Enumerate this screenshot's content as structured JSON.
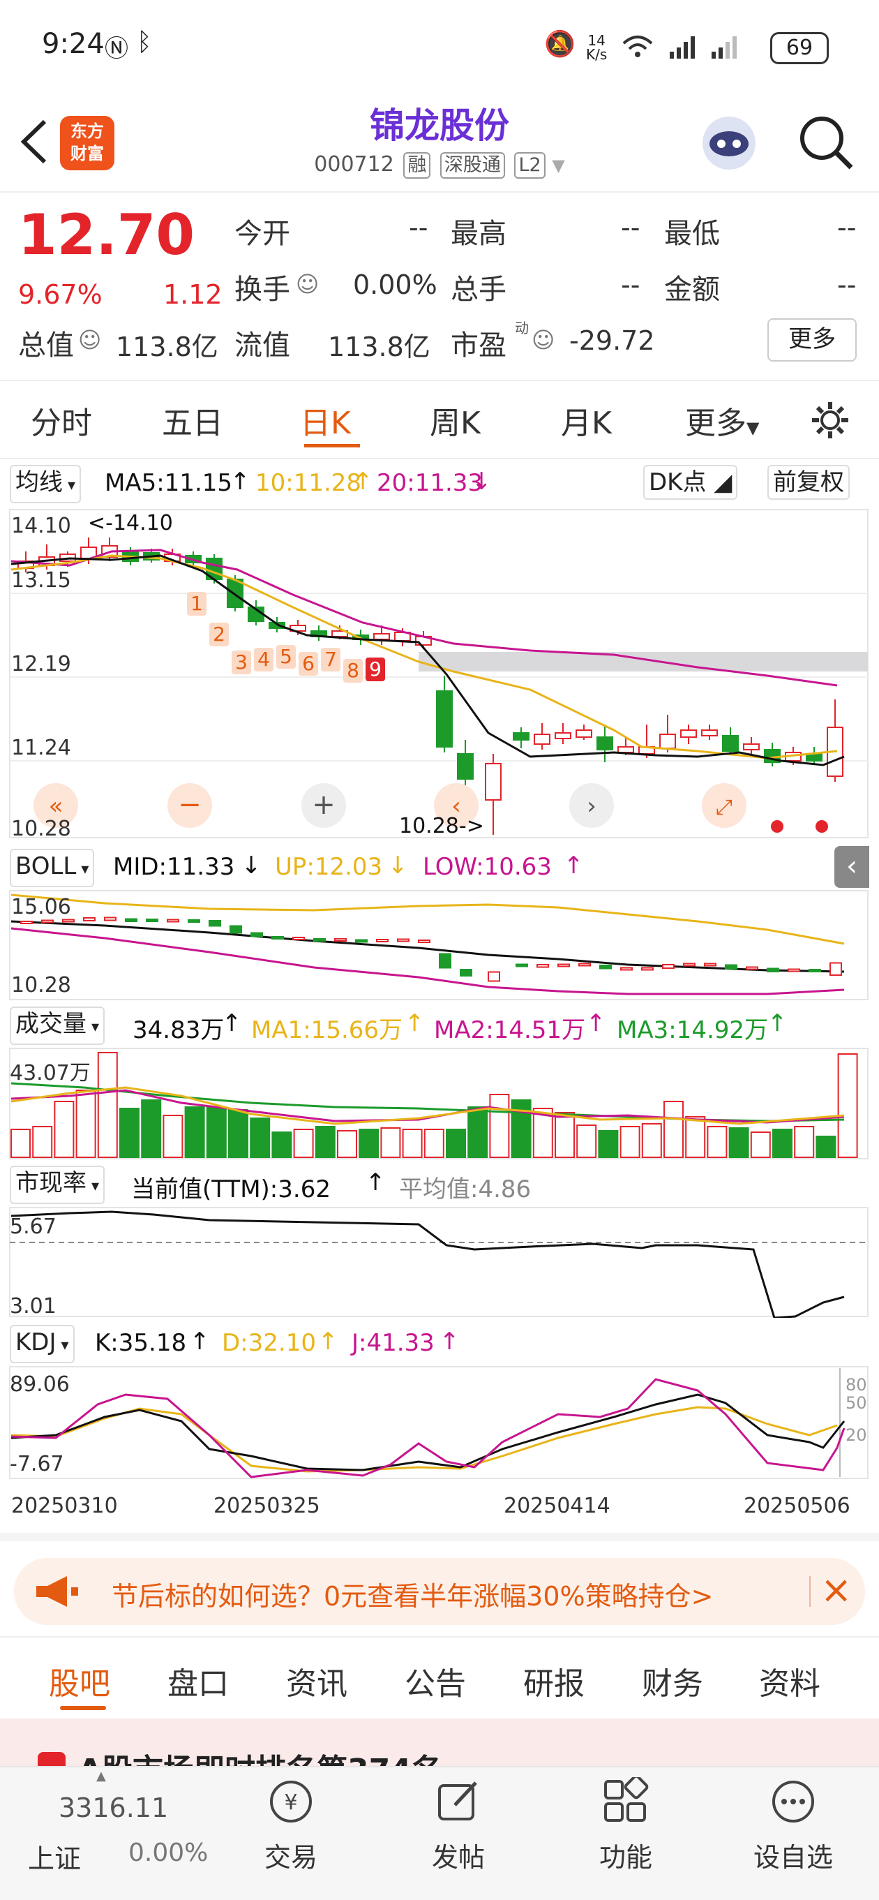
{
  "status": {
    "time": "9:24",
    "netspeed_top": "14",
    "netspeed_unit": "K/s",
    "battery": "69"
  },
  "header": {
    "title": "锦龙股份",
    "code": "000712",
    "tags": [
      "融",
      "深股通",
      "L2"
    ],
    "logo_line1": "东方",
    "logo_line2": "财富"
  },
  "quote": {
    "price": "12.70",
    "change_pct": "9.67%",
    "change": "1.12",
    "open_label": "今开",
    "open": "--",
    "high_label": "最高",
    "high": "--",
    "low_label": "最低",
    "low": "--",
    "turnover_label": "换手",
    "turnover": "0.00%",
    "volume_label": "总手",
    "volume": "--",
    "amount_label": "金额",
    "amount": "--",
    "mktcap_label": "总值",
    "mktcap": "113.8亿",
    "float_label": "流值",
    "float": "113.8亿",
    "pe_label": "市盈",
    "pe_sup": "动",
    "pe": "-29.72",
    "more": "更多"
  },
  "tabs": [
    "分时",
    "五日",
    "日K",
    "周K",
    "月K",
    "更多"
  ],
  "active_tab": 2,
  "main_chart": {
    "ma_selector": "均线",
    "ma5": "MA5:11.15",
    "ma10": "10:11.28",
    "ma20": "20:11.33",
    "dk_button": "DK点",
    "adjust_button": "前复权",
    "y_labels": [
      "14.10",
      "13.15",
      "12.19",
      "11.24",
      "10.28"
    ],
    "high_marker": "<-14.10",
    "low_marker": "10.28->",
    "td_numbers": [
      "1",
      "2",
      "3",
      "4",
      "5",
      "6",
      "7",
      "8",
      "9"
    ]
  },
  "boll": {
    "selector": "BOLL",
    "mid": "MID:11.33",
    "up": "UP:12.03",
    "low": "LOW:10.63",
    "y_top": "15.06",
    "y_bottom": "10.28"
  },
  "volume": {
    "selector": "成交量",
    "value": "34.83万",
    "ma1": "MA1:15.66万",
    "ma2": "MA2:14.51万",
    "ma3": "MA3:14.92万",
    "y_top": "43.07万"
  },
  "pcf": {
    "selector": "市现率",
    "current": "当前值(TTM):3.62",
    "avg": "平均值:4.86",
    "y_top": "5.67",
    "y_bottom": "3.01"
  },
  "kdj": {
    "selector": "KDJ",
    "k": "K:35.18",
    "d": "D:32.10",
    "j": "J:41.33",
    "y_top": "89.06",
    "y_bottom": "-7.67",
    "r80": "80",
    "r50": "50",
    "r20": "20"
  },
  "x_dates": [
    "20250310",
    "20250325",
    "20250414",
    "20250506"
  ],
  "banner": {
    "text": "节后标的如何选？0元查看半年涨幅30%策略持仓>"
  },
  "section_tabs": [
    "股吧",
    "盘口",
    "资讯",
    "公告",
    "研报",
    "财务",
    "资料"
  ],
  "section_peek": "A股市场即时排名第374名",
  "bottom": {
    "index_value": "3316.11",
    "index_name": "上证",
    "index_pct": "0.00%",
    "nav": [
      "交易",
      "发帖",
      "功能",
      "设自选"
    ]
  },
  "colors": {
    "up": "#e3242b",
    "down": "#1c9b2b",
    "accent": "#e35b10",
    "title": "#6b2fd6",
    "ma10": "#e8b418",
    "ma20": "#c7158f"
  }
}
